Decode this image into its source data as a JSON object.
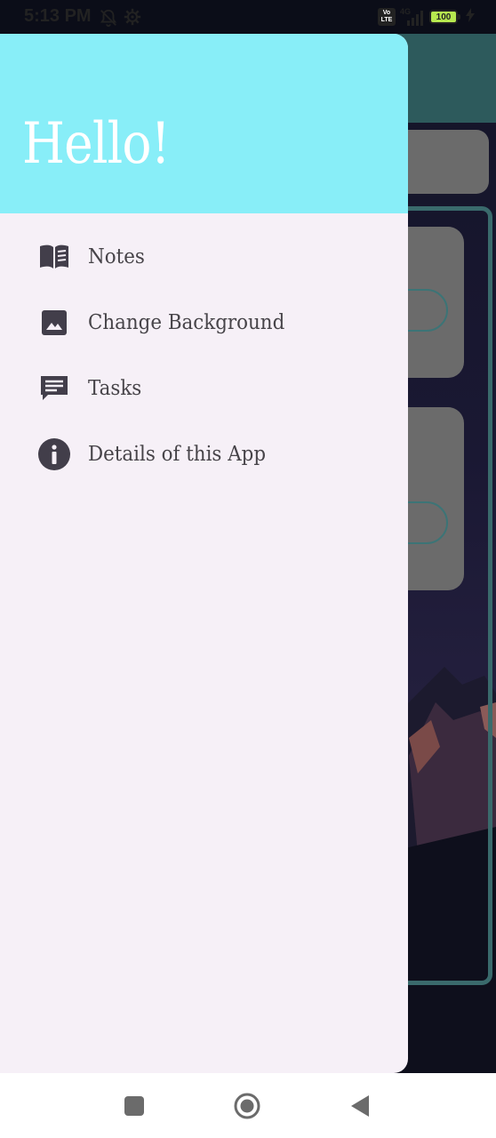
{
  "status_bar": {
    "time": "5:13 PM",
    "icons": [
      "notifications-off-icon",
      "settings-gear-icon",
      "volte-icon",
      "signal-icon",
      "battery-icon",
      "charging-icon"
    ],
    "volte_label": "Vo LTE",
    "network_label": "4G",
    "battery_level": "100"
  },
  "drawer": {
    "header_title": "Hello!",
    "header_color": "#88eef8",
    "background_color": "#f6f0f7",
    "items": [
      {
        "label": "Notes",
        "icon": "book-icon"
      },
      {
        "label": "Change Background",
        "icon": "image-icon"
      },
      {
        "label": "Tasks",
        "icon": "message-icon"
      },
      {
        "label": "Details of this App",
        "icon": "info-icon"
      }
    ]
  },
  "nav_bar": {
    "buttons": [
      "recents-square-icon",
      "home-circle-icon",
      "back-triangle-icon"
    ]
  },
  "colors": {
    "icon": "#423e4a",
    "text": "#474449",
    "app_bar_behind": "#2d5a5c"
  }
}
